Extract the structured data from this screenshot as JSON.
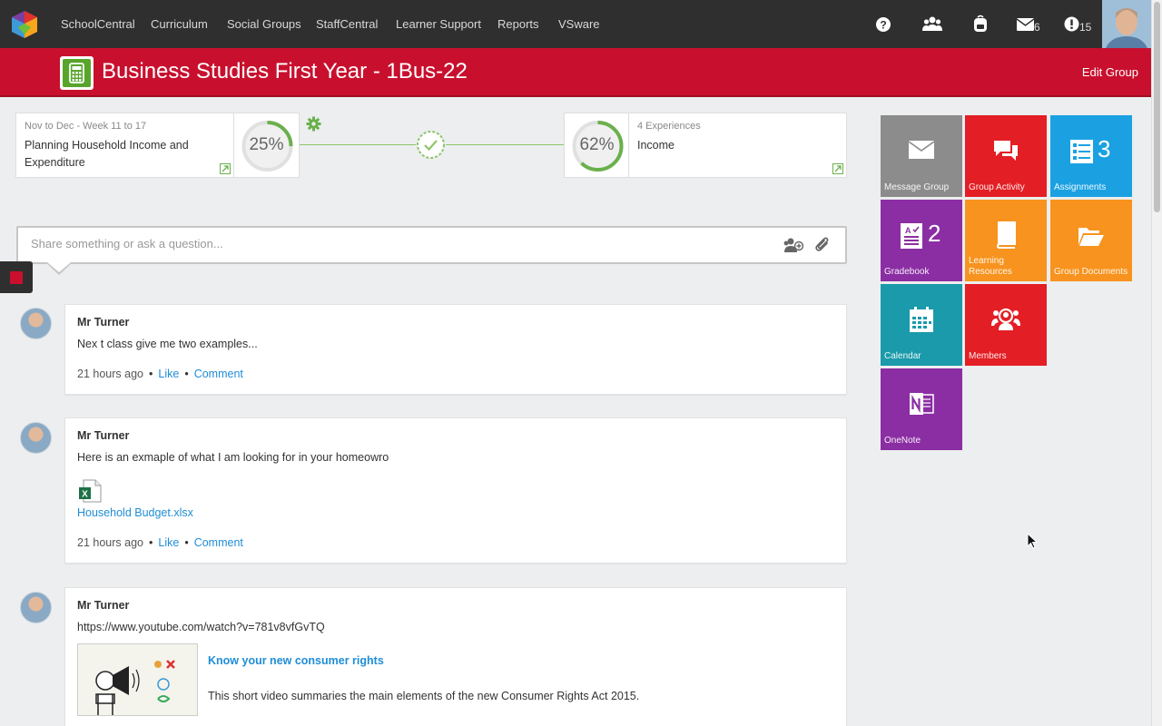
{
  "nav": {
    "items": [
      "SchoolCentral",
      "Curriculum",
      "Social Groups",
      "StaffCentral",
      "Learner Support",
      "Reports",
      "VSware"
    ],
    "icons": [
      "help-icon",
      "groups-icon",
      "backpack-icon",
      "mail-icon",
      "alert-icon"
    ],
    "mail_count": "6",
    "alert_count": "15"
  },
  "header": {
    "title": "Business Studies First Year - 1Bus-22",
    "edit_label": "Edit Group"
  },
  "progress": {
    "current": {
      "date_range": "Nov to Dec - Week 11 to 17",
      "title": "Planning Household Income and Expenditure",
      "percent_label": "25%",
      "percent": 25
    },
    "next": {
      "experiences": "4 Experiences",
      "title": "Income",
      "percent_label": "62%",
      "percent": 62
    }
  },
  "compose": {
    "placeholder": "Share something or ask a question..."
  },
  "posts": [
    {
      "author": "Mr Turner",
      "body": "Nex t class give me two examples...",
      "time": "21 hours ago",
      "like": "Like",
      "comment": "Comment"
    },
    {
      "author": "Mr Turner",
      "body": "Here is an exmaple of what I am looking for in your homeowro",
      "attachment": "Household Budget.xlsx",
      "time": "21 hours ago",
      "like": "Like",
      "comment": "Comment"
    },
    {
      "author": "Mr Turner",
      "body": "https://www.youtube.com/watch?v=781v8vfGvTQ",
      "video_title": "Know your new consumer rights",
      "video_desc": "This short video summaries the main elements of the new Consumer Rights Act 2015."
    }
  ],
  "tiles": {
    "message_group": "Message Group",
    "group_activity": "Group Activity",
    "assignments": "Assignments",
    "assignments_count": "3",
    "gradebook": "Gradebook",
    "gradebook_count": "2",
    "learning_resources": "Learning Resources",
    "group_documents": "Group Documents",
    "calendar": "Calendar",
    "members": "Members",
    "onenote": "OneNote"
  },
  "colors": {
    "nav_bg": "#2f2f2f",
    "header_red": "#c8102e",
    "progress_green": "#6ab04c",
    "link_blue": "#1f8dd6",
    "tile_gray": "#8c8c8c",
    "tile_red": "#e31e24",
    "tile_blue": "#1ba1e2",
    "tile_purple": "#8b2ea3",
    "tile_orange": "#f7931e",
    "tile_teal": "#1a9aaa"
  }
}
